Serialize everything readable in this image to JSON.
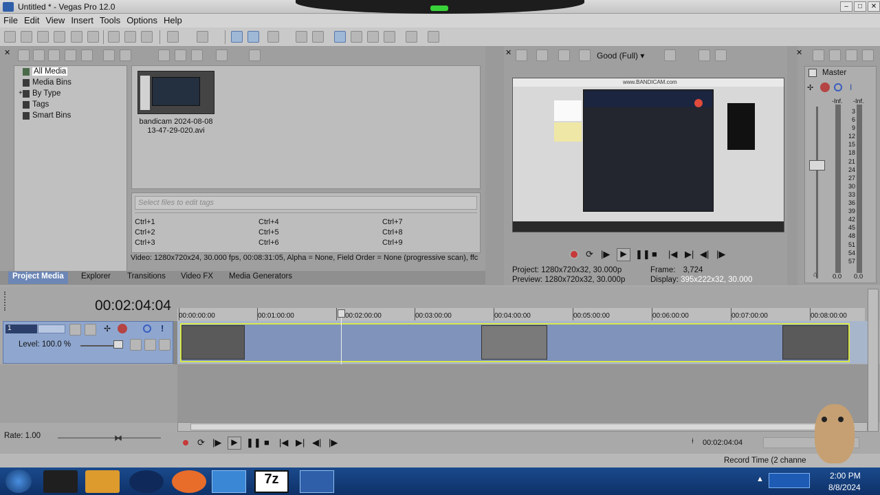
{
  "window": {
    "title": "Untitled * - Vegas Pro 12.0"
  },
  "menu": [
    "File",
    "Edit",
    "View",
    "Insert",
    "Tools",
    "Options",
    "Help"
  ],
  "media": {
    "tree": [
      "All Media",
      "Media Bins",
      "By Type",
      "Tags",
      "Smart Bins"
    ],
    "file_name_line1": "bandicam 2024-08-08",
    "file_name_line2": "13-47-29-020.avi",
    "tag_placeholder": "Select files to edit tags",
    "shortcuts": [
      "Ctrl+1",
      "Ctrl+2",
      "Ctrl+3",
      "Ctrl+4",
      "Ctrl+5",
      "Ctrl+6",
      "Ctrl+7",
      "Ctrl+8",
      "Ctrl+9"
    ],
    "info": "Video: 1280x720x24, 30.000 fps, 00:08:31:05, Alpha = None, Field Order = None (progressive scan), ffc"
  },
  "tabs": [
    "Project Media",
    "Explorer",
    "Transitions",
    "Video FX",
    "Media Generators"
  ],
  "preview": {
    "quality": "Good (Full)",
    "project_label": "Project:",
    "project_value": "1280x720x32, 30.000p",
    "preview_label": "Preview:",
    "preview_value": "1280x720x32, 30.000p",
    "frame_label": "Frame:",
    "frame_value": "3,724",
    "display_label": "Display:",
    "display_value": "395x222x32, 30.000",
    "watermark": "www.BANDICAM.com"
  },
  "master": {
    "label": "Master",
    "inf_left": "-Inf.",
    "inf_right": "-Inf.",
    "scale": [
      "3",
      "6",
      "9",
      "12",
      "15",
      "18",
      "21",
      "24",
      "27",
      "30",
      "33",
      "36",
      "39",
      "42",
      "45",
      "48",
      "51",
      "54",
      "57"
    ],
    "bottom_left": "0.0",
    "bottom_right": "0.0"
  },
  "timeline": {
    "timecode": "00:02:04:04",
    "ruler": [
      "00:00:00:00",
      "00:01:00:00",
      "00:02:00:00",
      "00:03:00:00",
      "00:04:00:00",
      "00:05:00:00",
      "00:06:00:00",
      "00:07:00:00",
      "00:08:00:00"
    ],
    "track_number": "1",
    "level": "Level: 100.0 %",
    "rate": "Rate: 1.00",
    "end_time": "00:02:04:04"
  },
  "status": {
    "record_time": "Record Time (2 channe"
  },
  "taskbar": {
    "time": "2:00 PM",
    "date": "8/8/2024"
  },
  "colors": {
    "accent": "#6c86b5",
    "clip_border": "#d9e84a",
    "track": "#7f93bb"
  }
}
